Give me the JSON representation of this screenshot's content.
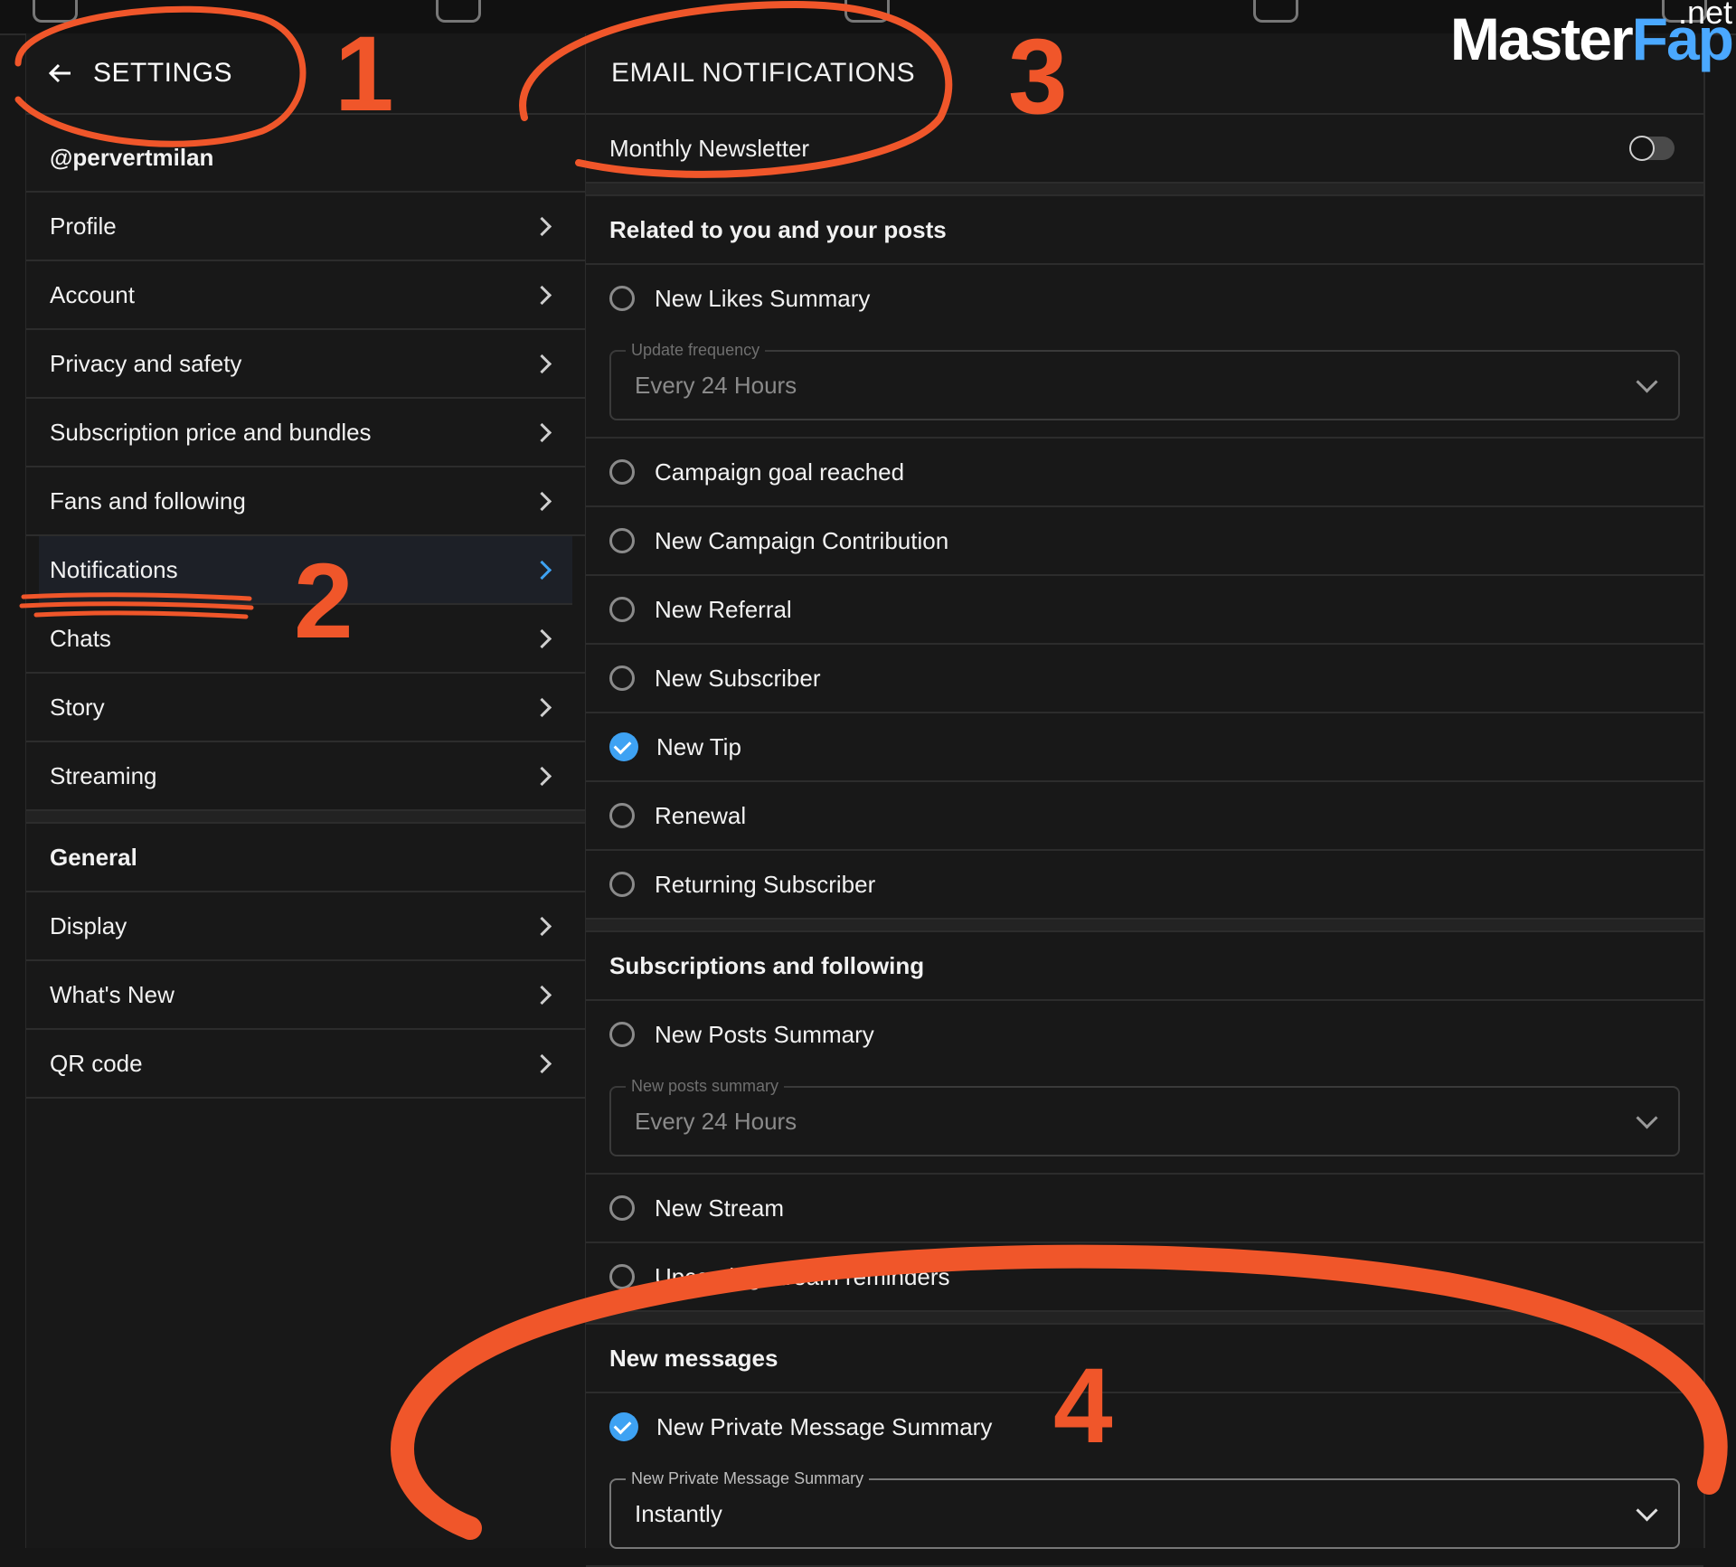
{
  "logo": {
    "part1": "Master",
    "part2": "Fap",
    "suffix": ".net"
  },
  "sidebar": {
    "title": "SETTINGS",
    "username": "@pervertmilan",
    "items": [
      {
        "label": "Profile"
      },
      {
        "label": "Account"
      },
      {
        "label": "Privacy and safety"
      },
      {
        "label": "Subscription price and bundles"
      },
      {
        "label": "Fans and following"
      },
      {
        "label": "Notifications"
      },
      {
        "label": "Chats"
      },
      {
        "label": "Story"
      },
      {
        "label": "Streaming"
      }
    ],
    "general_heading": "General",
    "general_items": [
      {
        "label": "Display"
      },
      {
        "label": "What's New"
      },
      {
        "label": "QR code"
      }
    ]
  },
  "main": {
    "title": "EMAIL NOTIFICATIONS",
    "newsletter_label": "Monthly Newsletter",
    "section1": "Related to you and your posts",
    "likes_label": "New Likes Summary",
    "likes_select": {
      "legend": "Update frequency",
      "value": "Every 24 Hours"
    },
    "section1_items": [
      {
        "label": "Campaign goal reached",
        "checked": false
      },
      {
        "label": "New Campaign Contribution",
        "checked": false
      },
      {
        "label": "New Referral",
        "checked": false
      },
      {
        "label": "New Subscriber",
        "checked": false
      },
      {
        "label": "New Tip",
        "checked": true
      },
      {
        "label": "Renewal",
        "checked": false
      },
      {
        "label": "Returning Subscriber",
        "checked": false
      }
    ],
    "section2": "Subscriptions and following",
    "posts_label": "New Posts Summary",
    "posts_select": {
      "legend": "New posts summary",
      "value": "Every 24 Hours"
    },
    "stream_label": "New Stream",
    "upcoming_label": "Upcoming stream reminders",
    "section3": "New messages",
    "pm_label": "New Private Message Summary",
    "pm_select": {
      "legend": "New Private Message Summary",
      "value": "Instantly"
    }
  },
  "annotations": {
    "n1": "1",
    "n2": "2",
    "n3": "3",
    "n4": "4"
  },
  "colors": {
    "accent": "#3ea2f3",
    "annotation": "#f0562a",
    "background": "#161616"
  }
}
